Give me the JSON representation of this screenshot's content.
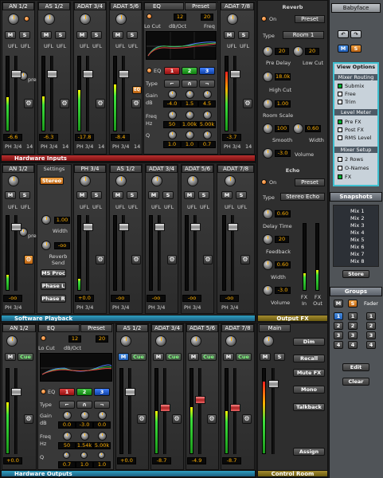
{
  "hw_inputs": {
    "title": "Hardware Inputs",
    "channels": [
      {
        "name": "AN 1/2",
        "level": "-6.6",
        "route": "PH 3/4",
        "trim": "14"
      },
      {
        "name": "AS 1/2",
        "level": "-6.3",
        "route": "PH 3/4",
        "trim": "14"
      },
      {
        "name": "ADAT 3/4",
        "level": "-17.8",
        "route": "PH 3/4",
        "trim": "14"
      },
      {
        "name": "ADAT 5/6",
        "level": "-8.4",
        "route": "PH 3/4",
        "trim": "14"
      },
      {
        "name": "ADAT 7/8",
        "level": "-3.7",
        "route": "PH 3/4",
        "trim": "14"
      }
    ],
    "eq": {
      "title": "EQ",
      "preset": "Preset",
      "lowcut_label": "Lo Cut",
      "lowcut_val": "12",
      "dboct_label": "dB/Oct",
      "dboct_val": "20",
      "freq_label": "Freq",
      "eq_label": "EQ",
      "bands": [
        "1",
        "2",
        "3"
      ],
      "type_label": "Type",
      "gain_label": "Gain",
      "db_label": "dB",
      "gain_vals": [
        "-4.0",
        "1.5",
        "4.5"
      ],
      "freq2_label": "Freq",
      "hz_label": "Hz",
      "freq_vals": [
        "50",
        "1.00k",
        "5.00k"
      ],
      "q_label": "Q",
      "q_vals": [
        "1.0",
        "1.0",
        "0.7"
      ]
    }
  },
  "sw_playback": {
    "title": "Software Playback",
    "settings": {
      "title": "Settings",
      "stereo": "Stereo",
      "width_label": "Width",
      "width_val": "1.00",
      "reverb_send": "Reverb\nSend",
      "send_val": "-oo",
      "ms_proc": "MS Proc",
      "phase_l": "Phase L",
      "phase_r": "Phase R"
    },
    "channels": [
      {
        "name": "AN 1/2",
        "level": "-oo",
        "route": "PH 3/4"
      },
      {
        "name": "PH 3/4",
        "level": "+0.0",
        "route": "PH 3/4"
      },
      {
        "name": "AS 1/2",
        "level": "-oo",
        "route": "PH 3/4"
      },
      {
        "name": "ADAT 3/4",
        "level": "-oo",
        "route": "PH 3/4"
      },
      {
        "name": "ADAT 5/6",
        "level": "-oo",
        "route": "PH 3/4"
      },
      {
        "name": "ADAT 7/8",
        "level": "-oo",
        "route": "PH 3/4"
      }
    ]
  },
  "hw_outputs": {
    "title": "Hardware Outputs",
    "channels": [
      {
        "name": "AN 1/2",
        "level": "+0.0"
      },
      {
        "name": "AS 1/2",
        "level": "+0.0"
      },
      {
        "name": "ADAT 3/4",
        "level": "-8.7"
      },
      {
        "name": "ADAT 5/6",
        "level": "-4.9"
      },
      {
        "name": "ADAT 7/8",
        "level": "-8.7"
      }
    ],
    "eq": {
      "title": "EQ",
      "preset": "Preset",
      "lowcut_label": "Lo Cut",
      "lowcut_val": "12",
      "dboct_label": "dB/Oct",
      "dboct_val": "20",
      "eq_label": "EQ",
      "bands": [
        "1",
        "2",
        "3"
      ],
      "type_label": "Type",
      "gain_vals": [
        "0.0",
        "-3.0",
        "0.0"
      ],
      "freq_vals": [
        "50",
        "1.54k",
        "5.00k"
      ],
      "q_vals": [
        "0.7",
        "1.0",
        "1.0"
      ],
      "gain_label": "Gain",
      "db_label": "dB",
      "freq_label": "Freq",
      "hz_label": "Hz",
      "q_label": "Q"
    },
    "mute": "M",
    "cue": "Cue"
  },
  "output_fx": {
    "title": "Output FX",
    "reverb": {
      "title": "Reverb",
      "on": "On",
      "preset": "Preset",
      "type_label": "Type",
      "type_val": "Room 1",
      "predelay_val": "20",
      "predelay_label": "Pre Delay",
      "lowcut_val": "20",
      "lowcut_label": "Low Cut",
      "highcut_val": "18.0k",
      "highcut_label": "High Cut",
      "roomscale_label": "Room Scale",
      "roomscale_val": "1.00",
      "smooth_val": "100",
      "smooth_label": "Smooth",
      "width_val": "0.60",
      "width_label": "Width",
      "volume_val": "-3.0",
      "volume_label": "Volume"
    },
    "echo": {
      "title": "Echo",
      "on": "On",
      "preset": "Preset",
      "type_label": "Type",
      "type_val": "Stereo Echo",
      "delay_val": "0.60",
      "delay_label": "Delay Time",
      "feedback_val": "20",
      "feedback_label": "Feedback",
      "width_val": "0.60",
      "width_label": "Width",
      "volume_val": "-3.0",
      "volume_label": "Volume"
    },
    "fx_in": "FX\nIn",
    "fx_out": "FX\nOut"
  },
  "control_room": {
    "title": "Control Room",
    "main": "Main",
    "dim": "Dim",
    "recall": "Recall",
    "mute_fx": "Mute FX",
    "mono": "Mono",
    "talkback": "Talkback",
    "assign": "Assign"
  },
  "sidebar": {
    "device": "Babyface",
    "view_options": "View Options",
    "mixer_routing": "Mixer Routing",
    "routing": [
      "Submix",
      "Free",
      "Trim"
    ],
    "level_meter": "Level Meter",
    "meter_opts": [
      "Pre FX",
      "Post FX",
      "RMS Level"
    ],
    "mixer_setup": "Mixer Setup",
    "setup_opts": [
      "2 Rows",
      "O-Names",
      "FX"
    ],
    "snapshots_title": "Snapshots",
    "mixes": [
      "Mix 1",
      "Mix 2",
      "Mix 3",
      "Mix 4",
      "Mix 5",
      "Mix 6",
      "Mix 7",
      "Mix 8"
    ],
    "store": "Store",
    "groups_title": "Groups",
    "group_m": "M",
    "group_s": "S",
    "group_fader": "Fader",
    "edit": "Edit",
    "clear": "Clear",
    "groups_left": [
      "1",
      "2",
      "3",
      "4"
    ],
    "groups_mid": [
      "1",
      "2",
      "3",
      "4"
    ],
    "groups_right": [
      "1",
      "2",
      "3",
      "4"
    ],
    "m_label": "M",
    "s_label": "S"
  },
  "common": {
    "mute": "M",
    "solo": "S",
    "ufl": "UFL",
    "pre": "pre",
    "eq": "EQ",
    "route": "PH 3/4"
  }
}
